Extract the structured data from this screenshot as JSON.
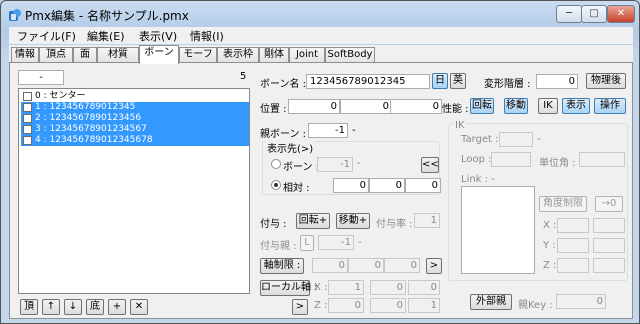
{
  "window": {
    "title": "Pmx編集 - 名称サンプル.pmx",
    "minimize": "─",
    "maximize": "□",
    "close": "✕"
  },
  "menu": [
    "ファイル(F)",
    "編集(E)",
    "表示(V)",
    "情報(I)"
  ],
  "tabs": [
    "情報",
    "頂点",
    "面",
    "材質",
    "ボーン",
    "モーフ",
    "表示枠",
    "剛体",
    "Joint",
    "SoftBody"
  ],
  "selected_tab": "ボーン",
  "bone_list": {
    "filter_value": "-",
    "count": "5",
    "items": [
      {
        "label": "0 : センター",
        "selected": false
      },
      {
        "label": "1 : 123456789012345",
        "selected": true
      },
      {
        "label": "2 : 1234567890123456",
        "selected": true
      },
      {
        "label": "3 : 12345678901234567",
        "selected": true
      },
      {
        "label": "4 : 123456789012345678",
        "selected": true
      }
    ],
    "buttons": [
      "頂",
      "↑",
      "↓",
      "底",
      "+",
      "✕"
    ]
  },
  "bone": {
    "name_label": "ボーン名 :",
    "name_value": "123456789012345",
    "lang_jp": "日",
    "lang_en": "英",
    "deform_label": "変形階層 :",
    "deform_value": "0",
    "after_physics": "物理後",
    "position_label": "位置 :",
    "position": [
      "0",
      "0",
      "0"
    ],
    "performance_label": "性能 :",
    "perf_buttons": [
      "回転",
      "移動",
      "IK",
      "表示",
      "操作"
    ],
    "parent_label": "親ボーン :",
    "parent_value": "-1",
    "parent_dash": "-"
  },
  "display_dest": {
    "title": "表示先(>)",
    "bone_label": "ボーン :",
    "bone_value": "-1",
    "bone_dash": "-",
    "jump": "<<",
    "relative_label": "相対 :",
    "relative": [
      "0",
      "0",
      "0"
    ]
  },
  "grant": {
    "label": "付与 :",
    "rot_btn": "回転+",
    "move_btn": "移動+",
    "rate_label": "付与率 :",
    "rate_value": "1",
    "parent_label": "付与親 :",
    "parent_l": "L",
    "parent_value": "-1",
    "parent_dash": "-"
  },
  "axis_limit": {
    "label": "軸制限 :",
    "values": [
      "0",
      "0",
      "0"
    ],
    "go": ">"
  },
  "local_axis": {
    "label": "ローカル軸 :",
    "x_label": "X :",
    "x_values": [
      "1",
      "0",
      "0"
    ],
    "z_label": "Z :",
    "z_values": [
      "0",
      "0",
      "1"
    ],
    "go": ">"
  },
  "ik": {
    "title": "IK",
    "target_label": "Target :",
    "target_dash": "-",
    "loop_label": "Loop :",
    "unit_label": "単位角 :",
    "link_label": "Link :",
    "link_dash": "-",
    "angle_limit": "角度制限",
    "arrow": "→0",
    "x_label": "X :",
    "y_label": "Y :",
    "z_label": "Z :"
  },
  "external": {
    "btn": "外部親",
    "key_label": "親Key :",
    "key_value": "0"
  }
}
